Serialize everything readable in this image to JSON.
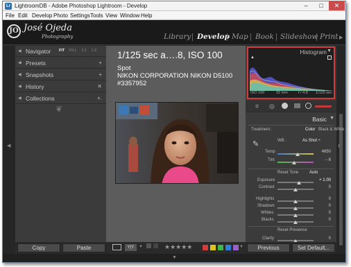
{
  "window": {
    "title": "LightroomDB - Adobe Photoshop Lightroom - Develop",
    "app_icon": "Lr"
  },
  "window_controls": {
    "minimize": "–",
    "maximize": "□",
    "close": "✕"
  },
  "menu": [
    "File",
    "Edit",
    "Develop",
    "Photo",
    "Settings",
    "Tools",
    "View",
    "Window",
    "Help"
  ],
  "brand": {
    "mark": "JO",
    "name": "José Ojeda",
    "sub": "Photography"
  },
  "modules": [
    "Library",
    "Develop",
    "Map",
    "Book",
    "Slideshow",
    "Print"
  ],
  "active_module": "Develop",
  "left_panel": {
    "navigator": {
      "label": "Navigator",
      "zoom": [
        "FIT",
        "FILL",
        "1:1",
        "1:2"
      ],
      "active_zoom": "FIT"
    },
    "sections": [
      {
        "label": "Presets",
        "action": "+"
      },
      {
        "label": "Snapshots",
        "action": "+"
      },
      {
        "label": "History",
        "action": "✕"
      },
      {
        "label": "Collections",
        "action": "+."
      }
    ],
    "ornament": "❦"
  },
  "photo_info": {
    "exposure": "1/125 sec a….8, ISO 100",
    "metering": "Spot",
    "camera": "NIKON CORPORATION NIKON D5100",
    "id": "#3357952"
  },
  "histogram": {
    "title": "Histogram",
    "iso": "ISO 100",
    "focal": "32 mm",
    "aperture": "f / 4.8",
    "shutter": "1/125 sec"
  },
  "basic": {
    "title": "Basic",
    "treatment_label": "Treatment :",
    "treatment_options": [
      "Color",
      "Black & White"
    ],
    "treatment_selected": "Color",
    "wb_label": "WB :",
    "wb_value": "As Shot ÷",
    "temp": {
      "label": "Temp",
      "value": "4650",
      "level": 0.55
    },
    "tint": {
      "label": "Tint",
      "value": "− 6",
      "level": 0.47
    },
    "reset_tone": "Reset Tone",
    "auto": "Auto",
    "exposure": {
      "label": "Exposure",
      "value": "+ 1.00",
      "level": 0.6
    },
    "contrast": {
      "label": "Contrast",
      "value": "0",
      "level": 0.5
    },
    "highlights": {
      "label": "Highlights",
      "value": "0",
      "level": 0.5
    },
    "shadows": {
      "label": "Shadows",
      "value": "0",
      "level": 0.5
    },
    "whites": {
      "label": "Whites",
      "value": "0",
      "level": 0.5
    },
    "blacks": {
      "label": "Blacks",
      "value": "0",
      "level": 0.5
    },
    "reset_presence": "Reset Presence",
    "clarity": {
      "label": "Clarity",
      "value": "0",
      "level": 0.5
    }
  },
  "bottom": {
    "copy": "Copy",
    "paste": "Paste",
    "previous": "Previous",
    "set_default": "Set Default...",
    "stars": "★★★★★",
    "color_labels": [
      "#d23b3b",
      "#e0c21f",
      "#3fb54a",
      "#2f7fd6",
      "#9a5fc8"
    ]
  }
}
